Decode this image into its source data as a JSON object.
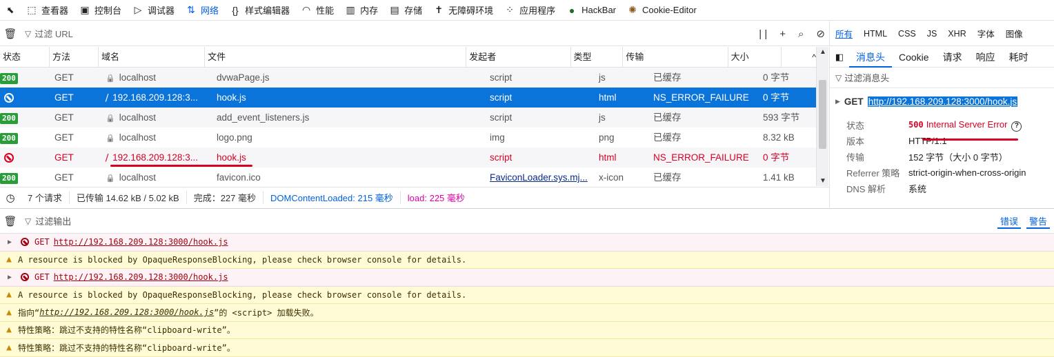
{
  "toolbar": {
    "tabs": [
      {
        "icon": "inspector-icon",
        "glyph": "⬚",
        "label": "查看器"
      },
      {
        "icon": "console-icon",
        "glyph": "▣",
        "label": "控制台"
      },
      {
        "icon": "debugger-icon",
        "glyph": "▷",
        "label": "调试器"
      },
      {
        "icon": "network-icon",
        "glyph": "⇅",
        "label": "网络"
      },
      {
        "icon": "style-editor-icon",
        "glyph": "{}",
        "label": "样式编辑器"
      },
      {
        "icon": "performance-icon",
        "glyph": "◠",
        "label": "性能"
      },
      {
        "icon": "memory-icon",
        "glyph": "▥",
        "label": "内存"
      },
      {
        "icon": "storage-icon",
        "glyph": "▤",
        "label": "存储"
      },
      {
        "icon": "accessibility-icon",
        "glyph": "✝",
        "label": "无障碍环境"
      },
      {
        "icon": "application-icon",
        "glyph": "⁘",
        "label": "应用程序"
      },
      {
        "icon": "hackbar-icon",
        "glyph": "●",
        "label": "HackBar"
      },
      {
        "icon": "cookie-editor-icon",
        "glyph": "✺",
        "label": "Cookie-Editor"
      }
    ],
    "active_tab": "网络"
  },
  "network": {
    "filter_placeholder": "过滤 URL",
    "type_filters": [
      "所有",
      "HTML",
      "CSS",
      "JS",
      "XHR",
      "字体",
      "图像"
    ],
    "columns": [
      "状态",
      "方法",
      "域名",
      "文件",
      "发起者",
      "类型",
      "传输",
      "大小"
    ],
    "rows": [
      {
        "status": "200",
        "method": "GET",
        "domain": "localhost",
        "file": "dvwaPage.js",
        "initiator": "script",
        "type": "js",
        "transfer": "已缓存",
        "size": "0 字节",
        "state": "normal"
      },
      {
        "status": "blocked",
        "method": "GET",
        "domain": "192.168.209.128:3...",
        "file": "hook.js",
        "initiator": "script",
        "type": "html",
        "transfer": "NS_ERROR_FAILURE",
        "size": "0 字节",
        "state": "selected"
      },
      {
        "status": "200",
        "method": "GET",
        "domain": "localhost",
        "file": "add_event_listeners.js",
        "initiator": "script",
        "type": "js",
        "transfer": "已缓存",
        "size": "593 字节",
        "state": "normal"
      },
      {
        "status": "200",
        "method": "GET",
        "domain": "localhost",
        "file": "logo.png",
        "initiator": "img",
        "type": "png",
        "transfer": "已缓存",
        "size": "8.32 kB",
        "state": "normal"
      },
      {
        "status": "blocked",
        "method": "GET",
        "domain": "192.168.209.128:3...",
        "file": "hook.js",
        "initiator": "script",
        "type": "html",
        "transfer": "NS_ERROR_FAILURE",
        "size": "0 字节",
        "state": "errored"
      },
      {
        "status": "200",
        "method": "GET",
        "domain": "localhost",
        "file": "favicon.ico",
        "initiator": "FaviconLoader.sys.mj...",
        "type": "x-icon",
        "transfer": "已缓存",
        "size": "1.41 kB",
        "state": "normal"
      }
    ],
    "summary": {
      "requests": "7 个请求",
      "transferred": "已传输 14.62 kB / 5.02 kB",
      "finish": "完成：227 毫秒",
      "dcl": "DOMContentLoaded: 215 毫秒",
      "load": "load: 225 毫秒",
      "dcl_color": "#0060df",
      "load_color": "#dd00a9"
    }
  },
  "details": {
    "tabs": [
      "消息头",
      "Cookie",
      "请求",
      "响应",
      "耗时"
    ],
    "active_tab": "消息头",
    "filter_placeholder": "过滤消息头",
    "method": "GET",
    "url": "http://192.168.209.128:3000/hook.js",
    "fields": [
      {
        "key": "状态",
        "value": "500 Internal Server Error"
      },
      {
        "key": "版本",
        "value": "HTTP/1.1"
      },
      {
        "key": "传输",
        "value": "152 字节（大小 0 字节）"
      },
      {
        "key": "Referrer 策略",
        "value": "strict-origin-when-cross-origin"
      },
      {
        "key": "DNS 解析",
        "value": "系统"
      }
    ],
    "status_code": "500",
    "status_text": "Internal Server Error"
  },
  "console": {
    "filter_placeholder": "过滤输出",
    "buttons": [
      "错误",
      "警告"
    ],
    "lines": [
      {
        "kind": "error",
        "prefix": "GET",
        "link": "http://192.168.209.128:3000/hook.js"
      },
      {
        "kind": "warn",
        "text": "A resource is blocked by OpaqueResponseBlocking, please check browser console for details."
      },
      {
        "kind": "error",
        "prefix": "GET",
        "link": "http://192.168.209.128:3000/hook.js"
      },
      {
        "kind": "warn",
        "text": "A resource is blocked by OpaqueResponseBlocking, please check browser console for details."
      },
      {
        "kind": "warn",
        "pre": "指向“",
        "link": "http://192.168.209.128:3000/hook.js",
        "post": "”的 <script> 加载失败。"
      },
      {
        "kind": "warn",
        "text": "特性策略：跳过不支持的特性名称“clipboard-write”。"
      },
      {
        "kind": "warn",
        "text": "特性策略：跳过不支持的特性名称“clipboard-write”。"
      }
    ]
  },
  "colors": {
    "accent": "#0060df",
    "selected_row": "#0a74da",
    "error": "#d70022",
    "ok_badge": "#2a9d3a"
  }
}
